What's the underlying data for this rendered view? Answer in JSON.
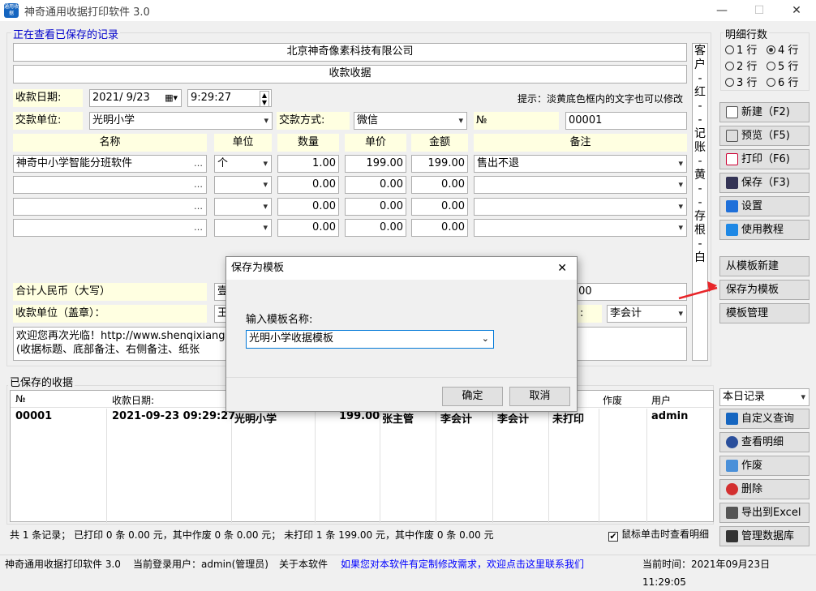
{
  "window": {
    "title": "神奇通用收据打印软件 3.0",
    "icon_text": "通用收据",
    "min": "—",
    "max": "☐",
    "close": "✕"
  },
  "viewing_label": "正在查看已保存的记录",
  "company": "北京神奇像素科技有限公司",
  "receipt_title": "收款收据",
  "side_label": [
    "客",
    "户",
    "-",
    "红",
    "-",
    "-",
    "记",
    "账",
    "-",
    "黄",
    "-",
    "-",
    "存",
    "根",
    "-",
    "白"
  ],
  "date_label": "收款日期:",
  "date_value": "2021/ 9/23",
  "time_value": "9:29:27",
  "hint": "提示：淡黄底色框内的文字也可以修改",
  "payer_label": "交款单位:",
  "payer_value": "光明小学",
  "method_label": "交款方式:",
  "method_value": "微信",
  "no_label": "№",
  "no_value": "00001",
  "cols": {
    "name": "名称",
    "unit": "单位",
    "qty": "数量",
    "price": "单价",
    "amount": "金额",
    "note": "备注"
  },
  "rows": [
    {
      "name": "神奇中小学智能分班软件",
      "unit": "个",
      "qty": "1.00",
      "price": "199.00",
      "amount": "199.00",
      "note": "售出不退"
    },
    {
      "name": "",
      "unit": "",
      "qty": "0.00",
      "price": "0.00",
      "amount": "0.00",
      "note": ""
    },
    {
      "name": "",
      "unit": "",
      "qty": "0.00",
      "price": "0.00",
      "amount": "0.00",
      "note": ""
    },
    {
      "name": "",
      "unit": "",
      "qty": "0.00",
      "price": "0.00",
      "amount": "0.00",
      "note": ""
    }
  ],
  "total_label": "合计人民币（大写）",
  "total_partial": "壹",
  "total_tail": ".00",
  "payee_label": "收款单位（盖章）：",
  "payee_partial": "王",
  "signer_colon": ":",
  "signer_value": "李会计",
  "footer_text1": "欢迎您再次光临！http://www.shenqixiang",
  "footer_text2": "(收据标题、底部备注、右侧备注、纸张",
  "rows_group": {
    "title": "明细行数",
    "options": [
      "1 行",
      "2 行",
      "3 行",
      "4 行",
      "5 行",
      "6 行"
    ],
    "selected": "4 行"
  },
  "side_buttons": [
    "新建（F2)",
    "预览（F5)",
    "打印（F6)",
    "保存（F3)",
    "设置",
    "使用教程"
  ],
  "template_buttons": [
    "从模板新建",
    "保存为模板",
    "模板管理"
  ],
  "saved_group": "已保存的收据",
  "grid_headers": {
    "no": "№",
    "date": "收款日期:",
    "void": "作废",
    "user": "用户"
  },
  "grid_row": {
    "no": "00001",
    "date": "2021-09-23 09:29:27",
    "payer": "光明小学",
    "amount": "199.00",
    "handler": "张主管",
    "cashier": "李会计",
    "accountant": "李会计",
    "print": "未打印",
    "user": "admin"
  },
  "filter": "本日记录",
  "list_buttons": [
    "自定义查询",
    "查看明细",
    "作废",
    "删除",
    "导出到Excel",
    "管理数据库"
  ],
  "summary": "共 1 条记录；   已打印 0 条 0.00 元，其中作废 0 条 0.00 元；   未打印 1 条 199.00 元，其中作废 0 条 0.00 元",
  "click_detail": "鼠标单击时查看明细",
  "status": {
    "app": "神奇通用收据打印软件 3.0",
    "user": "当前登录用户：admin(管理员)",
    "about": "关于本软件",
    "notice": "如果您对本软件有定制修改需求，欢迎点击这里联系我们",
    "time": "当前时间：2021年09月23日 11:29:05"
  },
  "dialog": {
    "title": "保存为模板",
    "close": "✕",
    "prompt": "输入模板名称:",
    "value": "光明小学收据模板",
    "ok": "确定",
    "cancel": "取消"
  },
  "colors": {
    "yellow": "#ffffe1",
    "arrow": "#e8262a",
    "link": "#0000ff"
  }
}
